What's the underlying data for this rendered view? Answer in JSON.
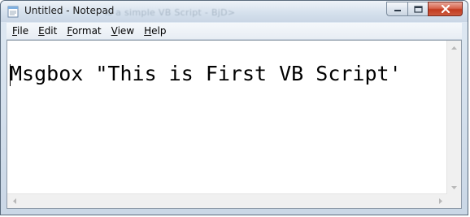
{
  "window": {
    "title": "Untitled - Notepad",
    "ghost_title": "is a simple VB Script - BjD>"
  },
  "icons": {
    "app": "notepad-icon",
    "minimize": "minimize-icon",
    "maximize": "maximize-icon",
    "close": "close-icon"
  },
  "menu": [
    {
      "key": "F",
      "rest": "ile"
    },
    {
      "key": "E",
      "rest": "dit"
    },
    {
      "key": "F",
      "rest": "ormat",
      "prefix": ""
    },
    {
      "key": "V",
      "rest": "iew"
    },
    {
      "key": "H",
      "rest": "elp"
    }
  ],
  "editor": {
    "content": "Msgbox \"This is First VB Script'"
  },
  "colors": {
    "close_button": "#c23b1f",
    "titlebar": "#d6e1ed"
  }
}
